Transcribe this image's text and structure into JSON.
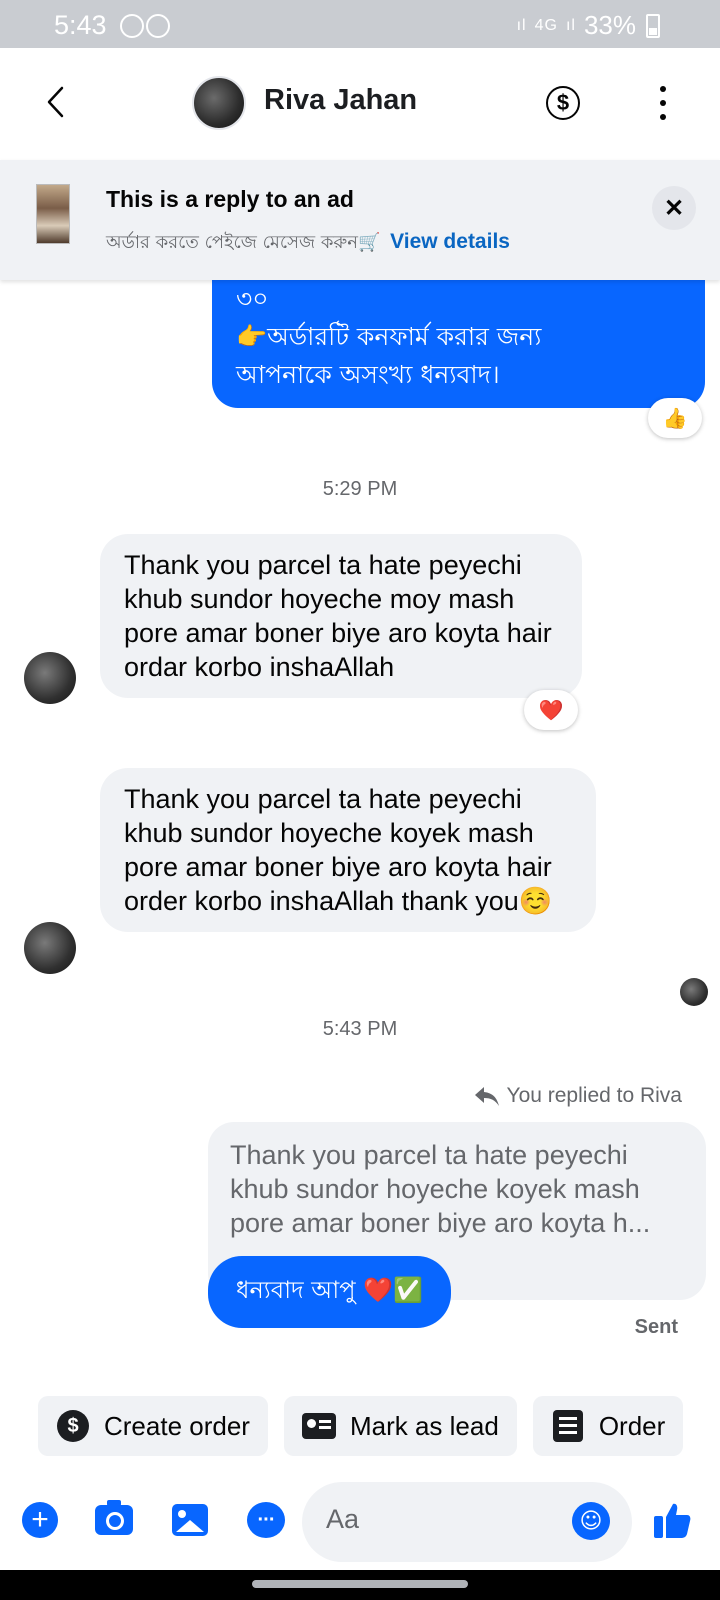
{
  "status_bar": {
    "time": "5:43",
    "network": "4G",
    "battery": "33%"
  },
  "header": {
    "contact_name": "Riva Jahan",
    "dollar_symbol": "$"
  },
  "ad_banner": {
    "title": "This is a reply to an ad",
    "subtitle": "অর্ডার করতে পেইজে মেসেজ করুন🛒",
    "link": "View details",
    "close": "✕"
  },
  "messages": {
    "outgoing_top": {
      "line1": "৩০",
      "line2": "👉অর্ডারটি কনফার্ম করার জন্য",
      "line3": "আপনাকে অসংখ্য ধন্যবাদ।",
      "reaction": "👍"
    },
    "time1": "5:29 PM",
    "incoming1": {
      "text": "Thank you parcel ta hate peyechi khub sundor hoyeche moy mash pore amar boner biye aro koyta hair ordar korbo inshaAllah",
      "reaction": "❤️"
    },
    "incoming2": {
      "text": "Thank you parcel ta hate peyechi khub sundor hoyeche koyek mash pore amar boner biye aro koyta hair order korbo inshaAllah thank you☺️"
    },
    "time2": "5:43 PM",
    "replied_label": "You replied to Riva",
    "quoted_text": "Thank you parcel ta hate peyechi khub sundor hoyeche koyek mash pore amar boner biye aro koyta h...",
    "reply_text": "ধন্যবাদ আপু ❤️✅",
    "sent_label": "Sent"
  },
  "chips": [
    {
      "label": "Create order",
      "icon": "dollar-icon"
    },
    {
      "label": "Mark as lead",
      "icon": "contact-card-icon"
    },
    {
      "label": "Order",
      "icon": "list-icon"
    }
  ],
  "composer": {
    "placeholder": "Aa",
    "chat_icon_text": "···"
  },
  "colors": {
    "accent": "#0866ff",
    "bubble_in": "#f0f2f5",
    "secondary_text": "#65676b",
    "link": "#0a66c2"
  }
}
